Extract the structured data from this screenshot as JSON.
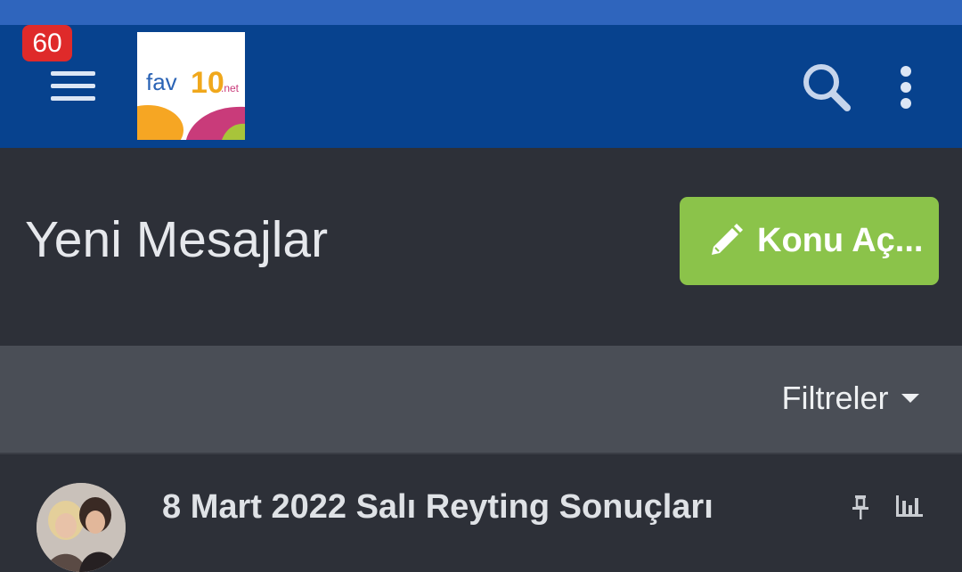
{
  "navbar": {
    "notification_count": "60",
    "logo": {
      "name": "fav10.net",
      "text_main": "fav",
      "text_num": "10",
      "text_suffix": ".net"
    },
    "icons": {
      "menu": "hamburger-icon",
      "search": "search-icon",
      "more": "more-vertical-icon"
    }
  },
  "page": {
    "title": "Yeni Mesajlar",
    "new_thread_label": "Konu Aç...",
    "new_thread_icon": "pencil-icon"
  },
  "filters": {
    "label": "Filtreler",
    "icon": "caret-down-icon"
  },
  "threads": [
    {
      "title": "8 Mart 2022 Salı Reyting Sonuçları",
      "icons": [
        "pin-icon",
        "stats-icon"
      ]
    }
  ],
  "colors": {
    "status_bar": "#2f65bd",
    "navbar": "#07428e",
    "badge": "#df2a2a",
    "accent_green": "#8bc34a",
    "background": "#2d3038",
    "filter_bar": "#4a4e56"
  }
}
